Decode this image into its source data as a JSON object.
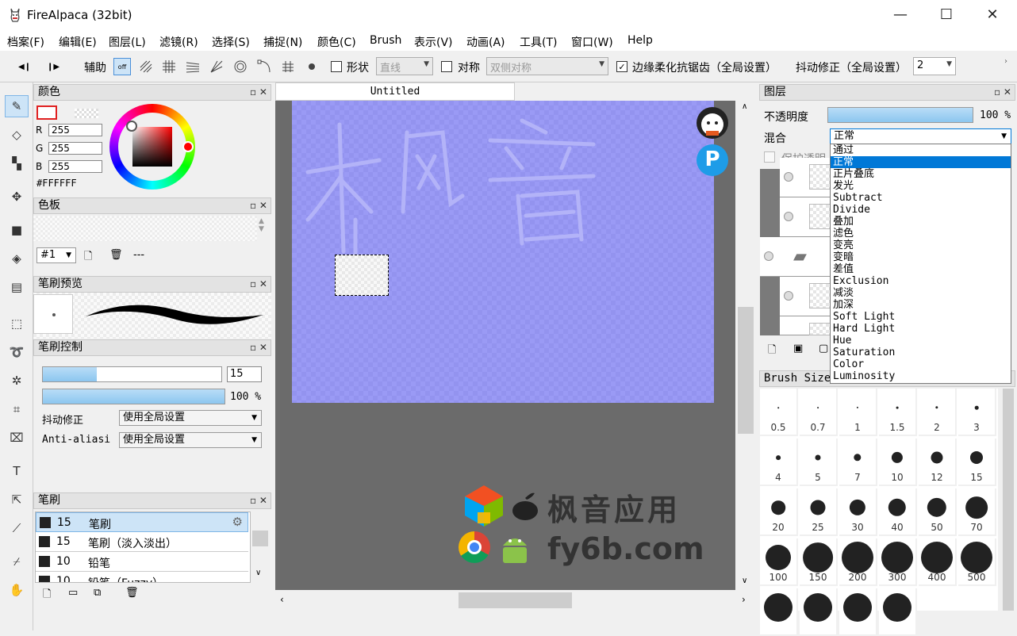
{
  "window": {
    "title": "FireAlpaca (32bit)",
    "minimize": "—",
    "maximize": "☐",
    "close": "✕"
  },
  "menu": [
    "档案(F)",
    "编辑(E)",
    "图层(L)",
    "滤镜(R)",
    "选择(S)",
    "捕捉(N)",
    "颜色(C)",
    "Brush",
    "表示(V)",
    "动画(A)",
    "工具(T)",
    "窗口(W)",
    "Help"
  ],
  "toolbar": {
    "assist_label": "辅助",
    "off_label": "off",
    "shape_label": "形状",
    "shape_value": "直线",
    "symmetry_label": "对称",
    "symmetry_value": "双侧对称",
    "antialias_label": "边缘柔化抗锯齿（全局设置）",
    "stabilizer_label": "抖动修正（全局设置）",
    "stabilizer_value": "2"
  },
  "color_panel": {
    "title": "颜色",
    "r_label": "R",
    "g_label": "G",
    "b_label": "B",
    "r": "255",
    "g": "255",
    "b": "255",
    "hex": "#FFFFFF"
  },
  "palette_panel": {
    "title": "色板",
    "palette_select": "#1",
    "palette_name": "---"
  },
  "brush_preview_panel": {
    "title": "笔刷预览"
  },
  "brush_control_panel": {
    "title": "笔刷控制",
    "size_value": "15",
    "opacity_value": "100 %",
    "size_fraction": 0.3,
    "opacity_fraction": 1.0,
    "stabilizer_label": "抖动修正",
    "stabilizer_value": "使用全局设置",
    "antialias_label": "Anti-aliasi",
    "antialias_value": "使用全局设置"
  },
  "brush_panel": {
    "title": "笔刷",
    "items": [
      {
        "size": "15",
        "name": "笔刷"
      },
      {
        "size": "15",
        "name": "笔刷（淡入淡出）"
      },
      {
        "size": "10",
        "name": "铅笔"
      },
      {
        "size": "10",
        "name": "铅笔（Fuzzy）"
      }
    ]
  },
  "document": {
    "tab_title": "Untitled"
  },
  "watermark": {
    "text_cn": "枫音应用",
    "text_url": "fy6b.com",
    "canvas_text": "枫音"
  },
  "layer_panel": {
    "title": "图层",
    "opacity_label": "不透明度",
    "opacity_value": "100 %",
    "blend_label": "混合",
    "blend_value": "正常",
    "protect_label": "保护透明",
    "blend_options": [
      "通过",
      "正常",
      "正片叠底",
      "发光",
      "Subtract",
      "Divide",
      "叠加",
      "滤色",
      "变亮",
      "变暗",
      "差值",
      "Exclusion",
      "减淡",
      "加深",
      "Soft Light",
      "Hard Light",
      "Hue",
      "Saturation",
      "Color",
      "Luminosity"
    ],
    "selected_index": 1
  },
  "brush_size_panel": {
    "title": "Brush Size",
    "sizes": [
      "0.5",
      "0.7",
      "1",
      "1.5",
      "2",
      "3",
      "4",
      "5",
      "7",
      "10",
      "12",
      "15",
      "20",
      "25",
      "30",
      "40",
      "50",
      "70",
      "100",
      "150",
      "200",
      "300",
      "400",
      "500"
    ]
  },
  "colors": {
    "accent": "#0078d7",
    "canvas": "#9a9af5",
    "workspace": "#6b6b6b"
  }
}
